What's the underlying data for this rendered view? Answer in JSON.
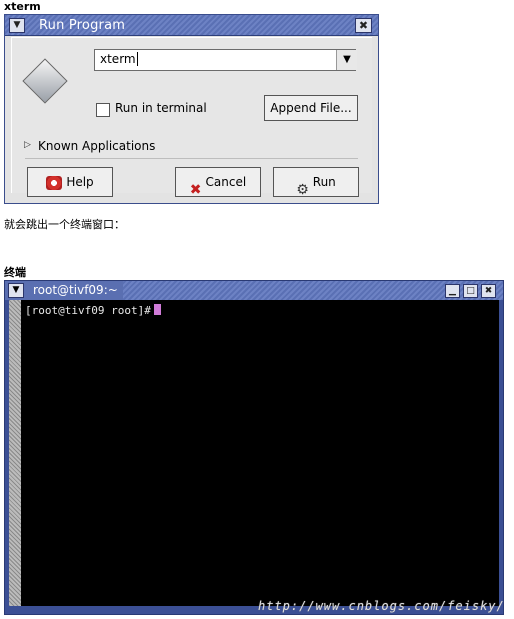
{
  "section1_heading": "xterm",
  "dialog": {
    "title": "Run Program",
    "command_value": "xterm",
    "run_in_terminal_label": "Run in terminal",
    "run_in_terminal_checked": false,
    "append_file_label": "Append File...",
    "known_applications_label": "Known Applications",
    "help_label": "Help",
    "cancel_label": "Cancel",
    "run_label": "Run"
  },
  "paragraph": "就会跳出一个终端窗口：",
  "section2_heading": "终端",
  "terminal": {
    "title": "root@tivf09:~",
    "prompt": "[root@tivf09 root]#"
  },
  "watermark": "http://www.cnblogs.com/feisky/",
  "colors": {
    "titlebar": "#5a70b4",
    "terminal_bg": "#000000",
    "cursor": "#d07cd8"
  }
}
